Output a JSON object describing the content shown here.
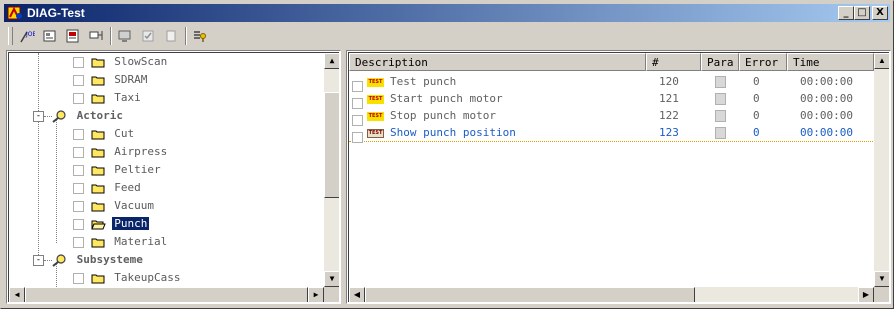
{
  "window": {
    "title": "DIAG-Test",
    "buttons": {
      "minimize": "_",
      "maximize": "□",
      "close": "X"
    }
  },
  "toolbar": {
    "buttons": [
      {
        "name": "job-icon"
      },
      {
        "name": "properties-icon"
      },
      {
        "name": "report-icon"
      },
      {
        "name": "monitor-icon"
      },
      {
        "name": "check-icon"
      },
      {
        "name": "blank-icon"
      },
      {
        "name": "list-key-icon"
      }
    ]
  },
  "tree": {
    "items": [
      {
        "label": "SlowScan",
        "level": 2,
        "checkbox": true,
        "folder": true
      },
      {
        "label": "SDRAM",
        "level": 2,
        "checkbox": true,
        "folder": true
      },
      {
        "label": "Taxi",
        "level": 2,
        "checkbox": true,
        "folder": true
      },
      {
        "label": "Actoric",
        "level": 1,
        "expander": "-",
        "checkbox": false,
        "folder": false,
        "bold": true
      },
      {
        "label": "Cut",
        "level": 2,
        "checkbox": true,
        "folder": true
      },
      {
        "label": "Airpress",
        "level": 2,
        "checkbox": true,
        "folder": true
      },
      {
        "label": "Peltier",
        "level": 2,
        "checkbox": true,
        "folder": true
      },
      {
        "label": "Feed",
        "level": 2,
        "checkbox": true,
        "folder": true
      },
      {
        "label": "Vacuum",
        "level": 2,
        "checkbox": true,
        "folder": true
      },
      {
        "label": "Punch",
        "level": 2,
        "checkbox": true,
        "folder": true,
        "selected": true,
        "open": true
      },
      {
        "label": "Material",
        "level": 2,
        "checkbox": true,
        "folder": true
      },
      {
        "label": "Subsysteme",
        "level": 1,
        "expander": "-",
        "checkbox": false,
        "folder": false,
        "bold": true
      },
      {
        "label": "TakeupCass",
        "level": 2,
        "checkbox": true,
        "folder": true
      }
    ]
  },
  "list": {
    "columns": [
      "Description",
      "#",
      "Para",
      "Error",
      "Time"
    ],
    "rows": [
      {
        "icon": "TEST",
        "description": "Test punch",
        "number": "120",
        "error": "0",
        "time": "00:00:00"
      },
      {
        "icon": "TEST",
        "description": "Start punch motor",
        "number": "121",
        "error": "0",
        "time": "00:00:00"
      },
      {
        "icon": "TEST",
        "description": "Stop punch motor",
        "number": "122",
        "error": "0",
        "time": "00:00:00"
      },
      {
        "icon": "TEST",
        "description": "Show punch position",
        "number": "123",
        "error": "0",
        "time": "00:00:00",
        "selected": true
      }
    ]
  },
  "colors": {
    "titlebar_start": "#0a246a",
    "titlebar_end": "#a6caf0",
    "selection": "#0a246a",
    "selected_row_text": "#1a5cc8"
  }
}
